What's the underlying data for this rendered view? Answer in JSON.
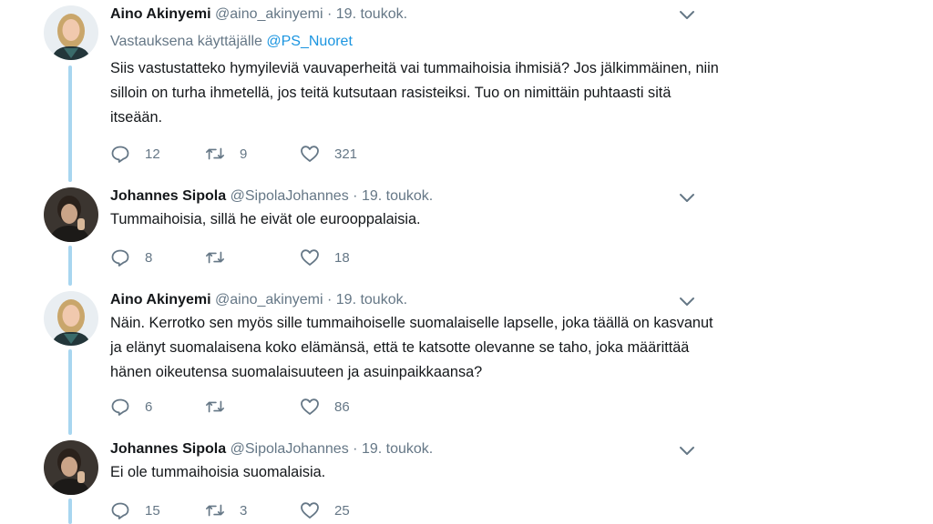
{
  "tweets": [
    {
      "name": "Aino Akinyemi",
      "handle": "@aino_akinyemi",
      "sep": "·",
      "date": "19. toukok.",
      "reply_prefix": "Vastauksena käyttäjälle",
      "reply_mention": "@PS_Nuoret",
      "text": "Siis vastustatteko hymyileviä vauvaperheitä vai tummaihoisia ihmisiä? Jos jälkimmäinen, niin silloin on turha ihmetellä, jos teitä kutsutaan rasisteiksi. Tuo on nimittäin puhtaasti sitä itseään.",
      "replies": "12",
      "retweets": "9",
      "likes": "321"
    },
    {
      "name": "Johannes Sipola",
      "handle": "@SipolaJohannes",
      "sep": "·",
      "date": "19. toukok.",
      "text": "Tummaihoisia, sillä he eivät ole eurooppalaisia.",
      "replies": "8",
      "retweets": "",
      "likes": "18"
    },
    {
      "name": "Aino Akinyemi",
      "handle": "@aino_akinyemi",
      "sep": "·",
      "date": "19. toukok.",
      "text": "Näin. Kerrotko sen myös sille tummaihoiselle suomalaiselle lapselle, joka täällä on kasvanut ja elänyt suomalaisena koko elämänsä, että te katsotte olevanne se taho, joka määrittää hänen oikeutensa suomalaisuuteen ja asuinpaikkaansa?",
      "replies": "6",
      "retweets": "",
      "likes": "86"
    },
    {
      "name": "Johannes Sipola",
      "handle": "@SipolaJohannes",
      "sep": "·",
      "date": "19. toukok.",
      "text": "Ei ole tummaihoisia suomalaisia.",
      "replies": "15",
      "retweets": "3",
      "likes": "25"
    }
  ],
  "icons": {
    "reply": "reply-icon",
    "retweet": "retweet-icon",
    "like": "heart-icon",
    "caret": "chevron-down-icon"
  },
  "colors": {
    "thread_line": "#a8d6f0",
    "mention": "#1b95e0",
    "secondary_text": "#657786"
  }
}
